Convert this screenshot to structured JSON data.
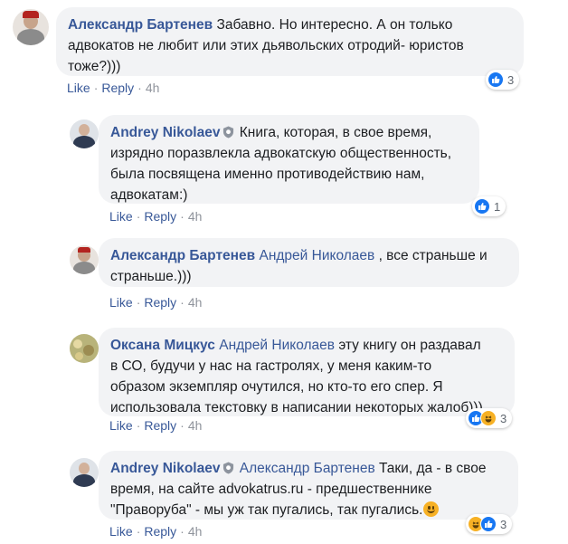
{
  "comments": [
    {
      "author": "Александр Бартенев",
      "text_lines": [
        "Забавно. Но интересно. А он только",
        "адвокатов не любит или этих дьявольских отродий- юристов",
        "тоже?)))"
      ],
      "first_line_text": "Забавно. Но интересно. А он только",
      "like": "Like",
      "reply": "Reply",
      "time": "4h",
      "reaction_count": "3",
      "reaction_icons": [
        "like-icon"
      ]
    },
    {
      "author": "Andrey Nikolaev",
      "verified_icon": "shield-badge-icon",
      "text_lines": [
        "Книга, которая, в свое время,",
        "изрядно поразвлекла адвокатскую общественность,",
        "была посвящена именно противодействию нам,",
        "адвокатам:)"
      ],
      "like": "Like",
      "reply": "Reply",
      "time": "4h",
      "reaction_count": "1",
      "reaction_icons": [
        "like-icon"
      ]
    },
    {
      "author": "Александр Бартенев",
      "mention": "Андрей Николаев",
      "text_after_mention": ", все страньше и",
      "text_lines": [
        "страньше.)))"
      ],
      "like": "Like",
      "reply": "Reply",
      "time": "4h"
    },
    {
      "author": "Оксана Мицкус",
      "mention": "Андрей Николаев",
      "text_after_mention": "эту книгу он раздавал",
      "text_lines": [
        "в СО, будучи у нас на гастролях, у меня каким-то",
        "образом экземпляр очутился, но кто-то его спер. Я",
        "использовала текстовку в написании некоторых жалоб)))"
      ],
      "like": "Like",
      "reply": "Reply",
      "time": "4h",
      "reaction_count": "3",
      "reaction_icons": [
        "like-icon",
        "haha-icon"
      ]
    },
    {
      "author": "Andrey Nikolaev",
      "verified_icon": "shield-badge-icon",
      "mention": "Александр Бартенев",
      "text_after_mention": "Таки, да - в свое",
      "text_lines": [
        "время, на сайте advokatrus.ru - предшественнике",
        "\"Праворуба\" - мы уж так пугались, так пугались."
      ],
      "emoji": "smile-emoji",
      "like": "Like",
      "reply": "Reply",
      "time": "4h",
      "reaction_count": "3",
      "reaction_icons": [
        "haha-icon",
        "like-icon"
      ]
    }
  ],
  "colors": {
    "link": "#385898",
    "bubble_bg": "#f2f3f5",
    "meta_gray": "#90949c",
    "like_blue": "#1877f2",
    "haha_yellow": "#f7b125"
  }
}
